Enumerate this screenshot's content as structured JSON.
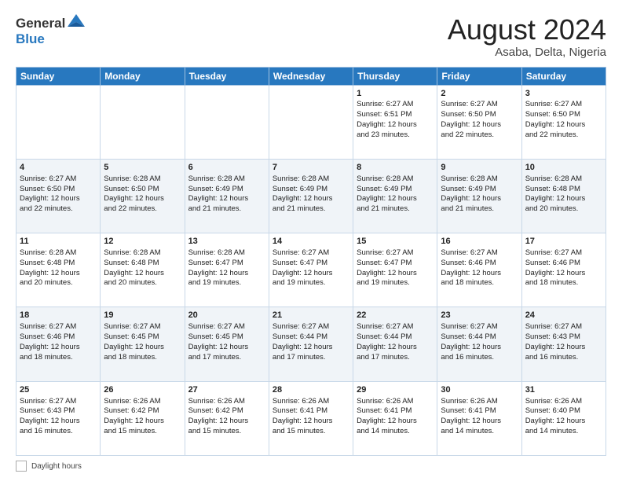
{
  "header": {
    "logo_general": "General",
    "logo_blue": "Blue",
    "month_title": "August 2024",
    "subtitle": "Asaba, Delta, Nigeria"
  },
  "days_of_week": [
    "Sunday",
    "Monday",
    "Tuesday",
    "Wednesday",
    "Thursday",
    "Friday",
    "Saturday"
  ],
  "weeks": [
    [
      {
        "day": "",
        "lines": []
      },
      {
        "day": "",
        "lines": []
      },
      {
        "day": "",
        "lines": []
      },
      {
        "day": "",
        "lines": []
      },
      {
        "day": "1",
        "lines": [
          "Sunrise: 6:27 AM",
          "Sunset: 6:51 PM",
          "Daylight: 12 hours",
          "and 23 minutes."
        ]
      },
      {
        "day": "2",
        "lines": [
          "Sunrise: 6:27 AM",
          "Sunset: 6:50 PM",
          "Daylight: 12 hours",
          "and 22 minutes."
        ]
      },
      {
        "day": "3",
        "lines": [
          "Sunrise: 6:27 AM",
          "Sunset: 6:50 PM",
          "Daylight: 12 hours",
          "and 22 minutes."
        ]
      }
    ],
    [
      {
        "day": "4",
        "lines": [
          "Sunrise: 6:27 AM",
          "Sunset: 6:50 PM",
          "Daylight: 12 hours",
          "and 22 minutes."
        ]
      },
      {
        "day": "5",
        "lines": [
          "Sunrise: 6:28 AM",
          "Sunset: 6:50 PM",
          "Daylight: 12 hours",
          "and 22 minutes."
        ]
      },
      {
        "day": "6",
        "lines": [
          "Sunrise: 6:28 AM",
          "Sunset: 6:49 PM",
          "Daylight: 12 hours",
          "and 21 minutes."
        ]
      },
      {
        "day": "7",
        "lines": [
          "Sunrise: 6:28 AM",
          "Sunset: 6:49 PM",
          "Daylight: 12 hours",
          "and 21 minutes."
        ]
      },
      {
        "day": "8",
        "lines": [
          "Sunrise: 6:28 AM",
          "Sunset: 6:49 PM",
          "Daylight: 12 hours",
          "and 21 minutes."
        ]
      },
      {
        "day": "9",
        "lines": [
          "Sunrise: 6:28 AM",
          "Sunset: 6:49 PM",
          "Daylight: 12 hours",
          "and 21 minutes."
        ]
      },
      {
        "day": "10",
        "lines": [
          "Sunrise: 6:28 AM",
          "Sunset: 6:48 PM",
          "Daylight: 12 hours",
          "and 20 minutes."
        ]
      }
    ],
    [
      {
        "day": "11",
        "lines": [
          "Sunrise: 6:28 AM",
          "Sunset: 6:48 PM",
          "Daylight: 12 hours",
          "and 20 minutes."
        ]
      },
      {
        "day": "12",
        "lines": [
          "Sunrise: 6:28 AM",
          "Sunset: 6:48 PM",
          "Daylight: 12 hours",
          "and 20 minutes."
        ]
      },
      {
        "day": "13",
        "lines": [
          "Sunrise: 6:28 AM",
          "Sunset: 6:47 PM",
          "Daylight: 12 hours",
          "and 19 minutes."
        ]
      },
      {
        "day": "14",
        "lines": [
          "Sunrise: 6:27 AM",
          "Sunset: 6:47 PM",
          "Daylight: 12 hours",
          "and 19 minutes."
        ]
      },
      {
        "day": "15",
        "lines": [
          "Sunrise: 6:27 AM",
          "Sunset: 6:47 PM",
          "Daylight: 12 hours",
          "and 19 minutes."
        ]
      },
      {
        "day": "16",
        "lines": [
          "Sunrise: 6:27 AM",
          "Sunset: 6:46 PM",
          "Daylight: 12 hours",
          "and 18 minutes."
        ]
      },
      {
        "day": "17",
        "lines": [
          "Sunrise: 6:27 AM",
          "Sunset: 6:46 PM",
          "Daylight: 12 hours",
          "and 18 minutes."
        ]
      }
    ],
    [
      {
        "day": "18",
        "lines": [
          "Sunrise: 6:27 AM",
          "Sunset: 6:46 PM",
          "Daylight: 12 hours",
          "and 18 minutes."
        ]
      },
      {
        "day": "19",
        "lines": [
          "Sunrise: 6:27 AM",
          "Sunset: 6:45 PM",
          "Daylight: 12 hours",
          "and 18 minutes."
        ]
      },
      {
        "day": "20",
        "lines": [
          "Sunrise: 6:27 AM",
          "Sunset: 6:45 PM",
          "Daylight: 12 hours",
          "and 17 minutes."
        ]
      },
      {
        "day": "21",
        "lines": [
          "Sunrise: 6:27 AM",
          "Sunset: 6:44 PM",
          "Daylight: 12 hours",
          "and 17 minutes."
        ]
      },
      {
        "day": "22",
        "lines": [
          "Sunrise: 6:27 AM",
          "Sunset: 6:44 PM",
          "Daylight: 12 hours",
          "and 17 minutes."
        ]
      },
      {
        "day": "23",
        "lines": [
          "Sunrise: 6:27 AM",
          "Sunset: 6:44 PM",
          "Daylight: 12 hours",
          "and 16 minutes."
        ]
      },
      {
        "day": "24",
        "lines": [
          "Sunrise: 6:27 AM",
          "Sunset: 6:43 PM",
          "Daylight: 12 hours",
          "and 16 minutes."
        ]
      }
    ],
    [
      {
        "day": "25",
        "lines": [
          "Sunrise: 6:27 AM",
          "Sunset: 6:43 PM",
          "Daylight: 12 hours",
          "and 16 minutes."
        ]
      },
      {
        "day": "26",
        "lines": [
          "Sunrise: 6:26 AM",
          "Sunset: 6:42 PM",
          "Daylight: 12 hours",
          "and 15 minutes."
        ]
      },
      {
        "day": "27",
        "lines": [
          "Sunrise: 6:26 AM",
          "Sunset: 6:42 PM",
          "Daylight: 12 hours",
          "and 15 minutes."
        ]
      },
      {
        "day": "28",
        "lines": [
          "Sunrise: 6:26 AM",
          "Sunset: 6:41 PM",
          "Daylight: 12 hours",
          "and 15 minutes."
        ]
      },
      {
        "day": "29",
        "lines": [
          "Sunrise: 6:26 AM",
          "Sunset: 6:41 PM",
          "Daylight: 12 hours",
          "and 14 minutes."
        ]
      },
      {
        "day": "30",
        "lines": [
          "Sunrise: 6:26 AM",
          "Sunset: 6:41 PM",
          "Daylight: 12 hours",
          "and 14 minutes."
        ]
      },
      {
        "day": "31",
        "lines": [
          "Sunrise: 6:26 AM",
          "Sunset: 6:40 PM",
          "Daylight: 12 hours",
          "and 14 minutes."
        ]
      }
    ]
  ],
  "footer": {
    "daylight_label": "Daylight hours"
  }
}
